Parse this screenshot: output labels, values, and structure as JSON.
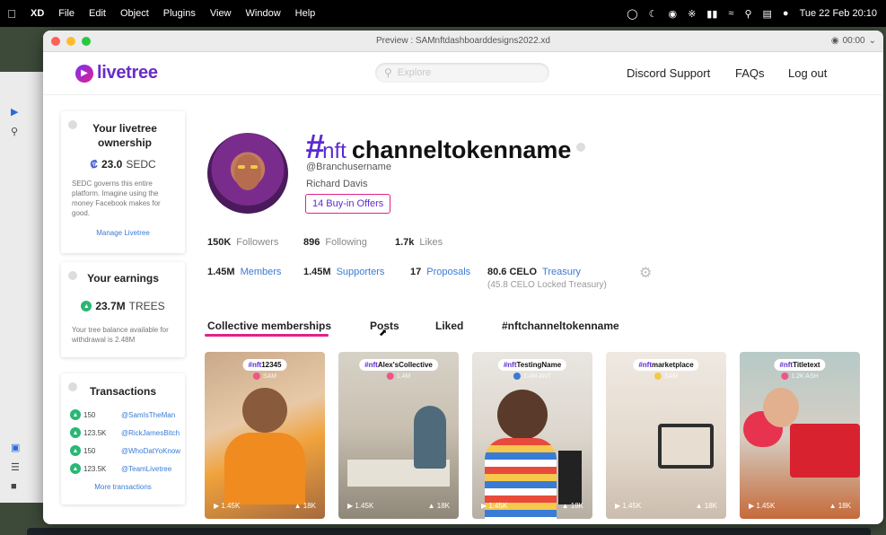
{
  "menubar": {
    "app": "XD",
    "items": [
      "File",
      "Edit",
      "Object",
      "Plugins",
      "View",
      "Window",
      "Help"
    ],
    "clock": "Tue 22 Feb  20:10"
  },
  "window": {
    "title": "Preview : SAMnftdashboarddesigns2022.xd",
    "timer": "00:00"
  },
  "header": {
    "logo": "livetree",
    "search_placeholder": "Explore",
    "nav": [
      "Discord Support",
      "FAQs",
      "Log out"
    ]
  },
  "ownership": {
    "title": "Your livetree ownership",
    "value": "23.0",
    "unit": "SEDC",
    "description": "SEDC governs this entire platform. Imagine using the money Facebook makes for good.",
    "link": "Manage Livetree"
  },
  "earnings": {
    "title": "Your earnings",
    "value": "23.7M",
    "unit": "TREES",
    "description": "Your tree balance available for withdrawal is 2.48M"
  },
  "transactions": {
    "title": "Transactions",
    "rows": [
      {
        "amount": "150",
        "user": "@SamIsTheMan"
      },
      {
        "amount": "123.5K",
        "user": "@RickJamesBitch"
      },
      {
        "amount": "150",
        "user": "@WhoDatYoKnow"
      },
      {
        "amount": "123.5K",
        "user": "@TeamLivetree"
      }
    ],
    "more": "More transactions"
  },
  "profile": {
    "hash": "#",
    "nft": "nft",
    "channel": "channeltokenname",
    "handle": "@Branchusername",
    "name": "Richard Davis",
    "offers": "14 Buy-in Offers"
  },
  "stats": {
    "followers_value": "150K",
    "followers_label": "Followers",
    "following_value": "896",
    "following_label": "Following",
    "likes_value": "1.7k",
    "likes_label": "Likes",
    "members_value": "1.45M",
    "members_label": "Members",
    "supporters_value": "1.45M",
    "supporters_label": "Supporters",
    "proposals_value": "17",
    "proposals_label": "Proposals",
    "treasury_value": "80.6 CELO",
    "treasury_label": "Treasury",
    "treasury_locked": "(45.8 CELO Locked Treasury)"
  },
  "tabs": [
    "Collective memberships",
    "Posts",
    "Liked",
    "#nftchanneltokenname"
  ],
  "nft_cards": [
    {
      "hash": "#nft",
      "title": "12345",
      "owner": "SAM",
      "plays": "1.45K",
      "likes": "18K"
    },
    {
      "hash": "#nft",
      "title": "Alex'sCollective",
      "owner": "1.4M",
      "plays": "1.45K",
      "likes": "18K"
    },
    {
      "hash": "#nft",
      "title": "TestingName",
      "owner": "1.4M ANT",
      "plays": "1.45K",
      "likes": "18K"
    },
    {
      "hash": "#nft",
      "title": "marketplace",
      "owner": "SAM",
      "plays": "1.45K",
      "likes": "18K"
    },
    {
      "hash": "#nft",
      "title": "Titletext",
      "owner": "1.2K ASH",
      "plays": "1.45K",
      "likes": "18K"
    }
  ],
  "colors": {
    "brand": "#6a2cc9",
    "accent": "#e0218a",
    "link": "#3a7bd5",
    "success": "#2bb673"
  }
}
